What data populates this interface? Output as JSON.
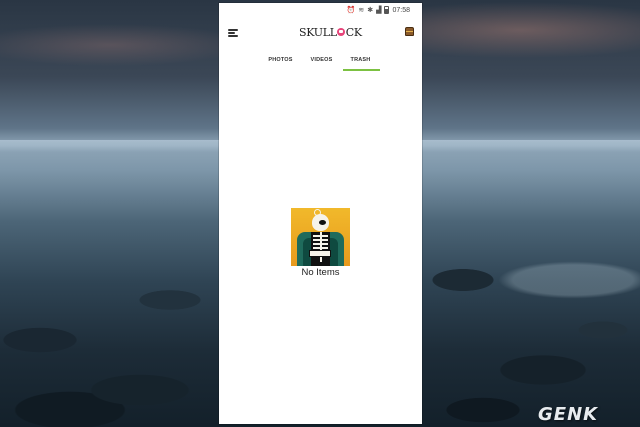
{
  "status_bar": {
    "time": "07:58"
  },
  "app": {
    "logo_left": "SKULL",
    "logo_right": "CK"
  },
  "tabs": [
    {
      "label": "PHOTOS",
      "active": false
    },
    {
      "label": "VIDEOS",
      "active": false
    },
    {
      "label": "TRASH",
      "active": true
    }
  ],
  "empty_state": {
    "message": "No Items"
  },
  "watermark": {
    "text": "GENK"
  },
  "colors": {
    "tab_indicator": "#7cc142",
    "logo_accent": "#e6457a"
  },
  "icons": {
    "menu": "hamburger-menu-icon",
    "chest": "treasure-chest-icon"
  }
}
